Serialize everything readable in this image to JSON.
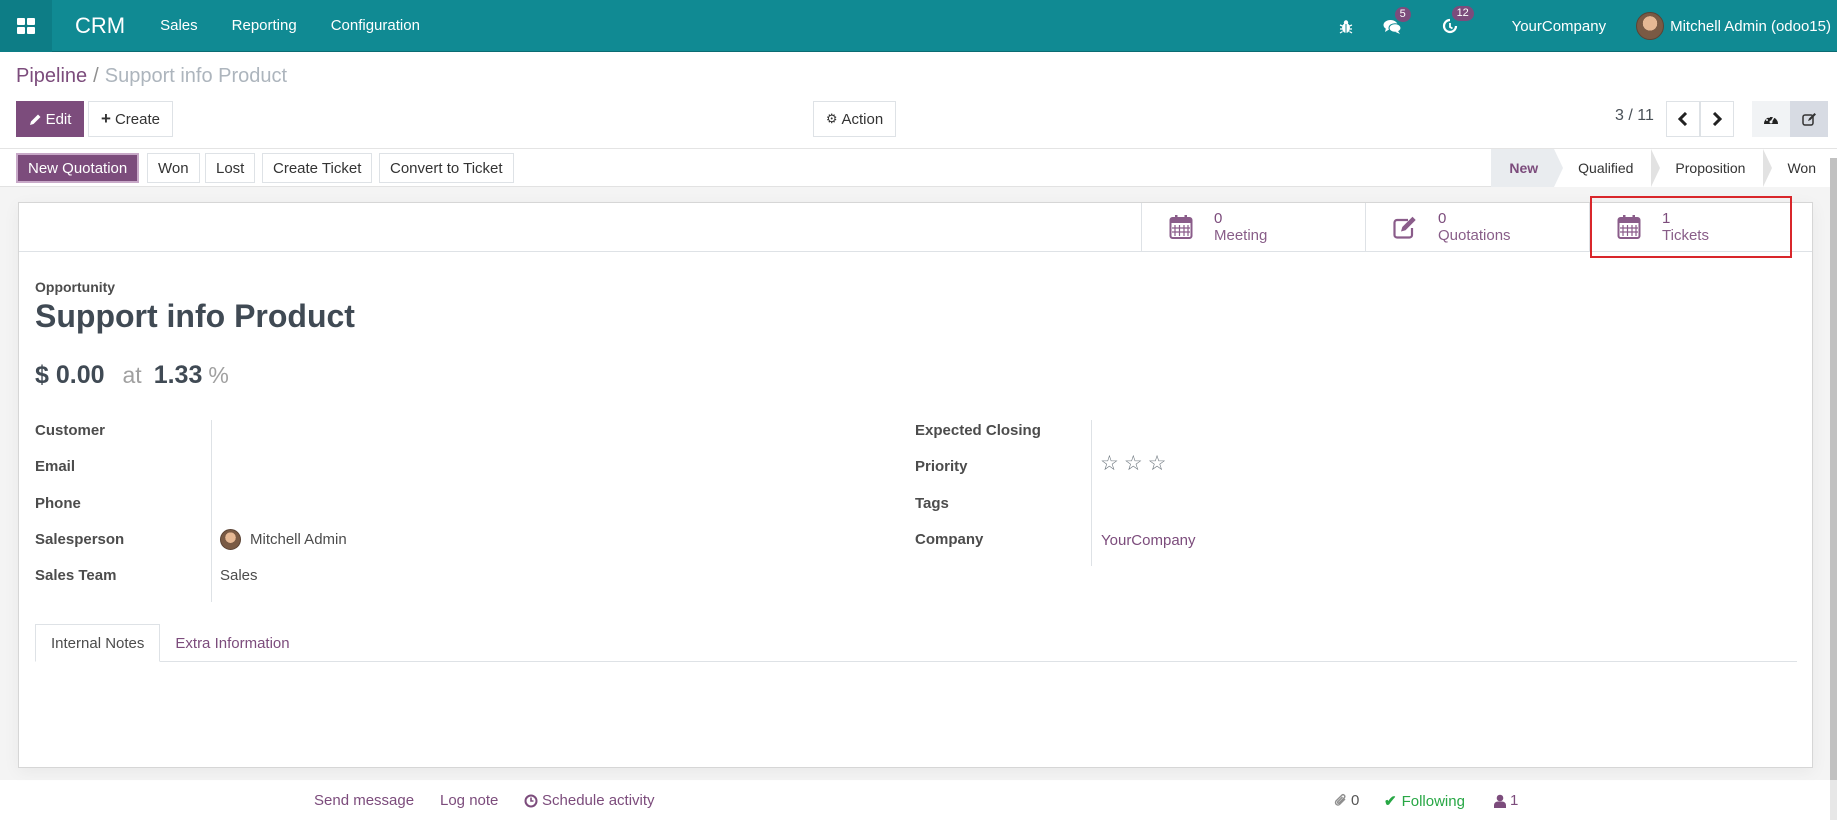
{
  "navbar": {
    "app_name": "CRM",
    "menu": [
      "Sales",
      "Reporting",
      "Configuration"
    ],
    "messages_count": "5",
    "activities_count": "12",
    "company": "YourCompany",
    "user": "Mitchell Admin (odoo15)",
    "icons": [
      "apps-grid-icon",
      "bug-icon",
      "chat-icon",
      "clock-icon",
      "avatar"
    ]
  },
  "breadcrumb": {
    "parent": "Pipeline",
    "separator": "/",
    "current": "Support info Product"
  },
  "control_panel": {
    "edit_label": "Edit",
    "create_label": "Create",
    "action_label": "Action",
    "pager": "3 / 11"
  },
  "header_buttons": [
    "New Quotation",
    "Won",
    "Lost",
    "Create Ticket",
    "Convert to Ticket"
  ],
  "stages": [
    {
      "label": "New",
      "current": true
    },
    {
      "label": "Qualified",
      "current": false
    },
    {
      "label": "Proposition",
      "current": false
    },
    {
      "label": "Won",
      "current": false
    }
  ],
  "stat_buttons": [
    {
      "value": "0",
      "label": "Meeting",
      "icon": "calendar-icon"
    },
    {
      "value": "0",
      "label": "Quotations",
      "icon": "edit-icon"
    },
    {
      "value": "1",
      "label": "Tickets",
      "icon": "calendar-icon",
      "highlighted": true
    }
  ],
  "record": {
    "type_label": "Opportunity",
    "name": "Support info Product",
    "revenue": "$ 0.00",
    "at_label": "at",
    "probability": "1.33",
    "percent_sign": "%"
  },
  "fields_left": [
    {
      "label": "Customer",
      "value": ""
    },
    {
      "label": "Email",
      "value": ""
    },
    {
      "label": "Phone",
      "value": ""
    },
    {
      "label": "Salesperson",
      "value": "Mitchell Admin"
    },
    {
      "label": "Sales Team",
      "value": "Sales"
    }
  ],
  "fields_right": [
    {
      "label": "Expected Closing",
      "value": ""
    },
    {
      "label": "Priority",
      "value": "0 of 3 stars"
    },
    {
      "label": "Tags",
      "value": ""
    },
    {
      "label": "Company",
      "value": "YourCompany"
    }
  ],
  "priority": {
    "filled": 0,
    "max": 3
  },
  "tabs": [
    {
      "label": "Internal Notes",
      "active": true
    },
    {
      "label": "Extra Information",
      "active": false
    }
  ],
  "chatter": {
    "send_message": "Send message",
    "log_note": "Log note",
    "schedule_activity": "Schedule activity",
    "attachments": "0",
    "following": "Following",
    "followers": "1"
  },
  "colors": {
    "navbar": "#108a93",
    "brand": "#7c4c7c",
    "following": "#28a745",
    "highlight_box": "#d9262b"
  }
}
